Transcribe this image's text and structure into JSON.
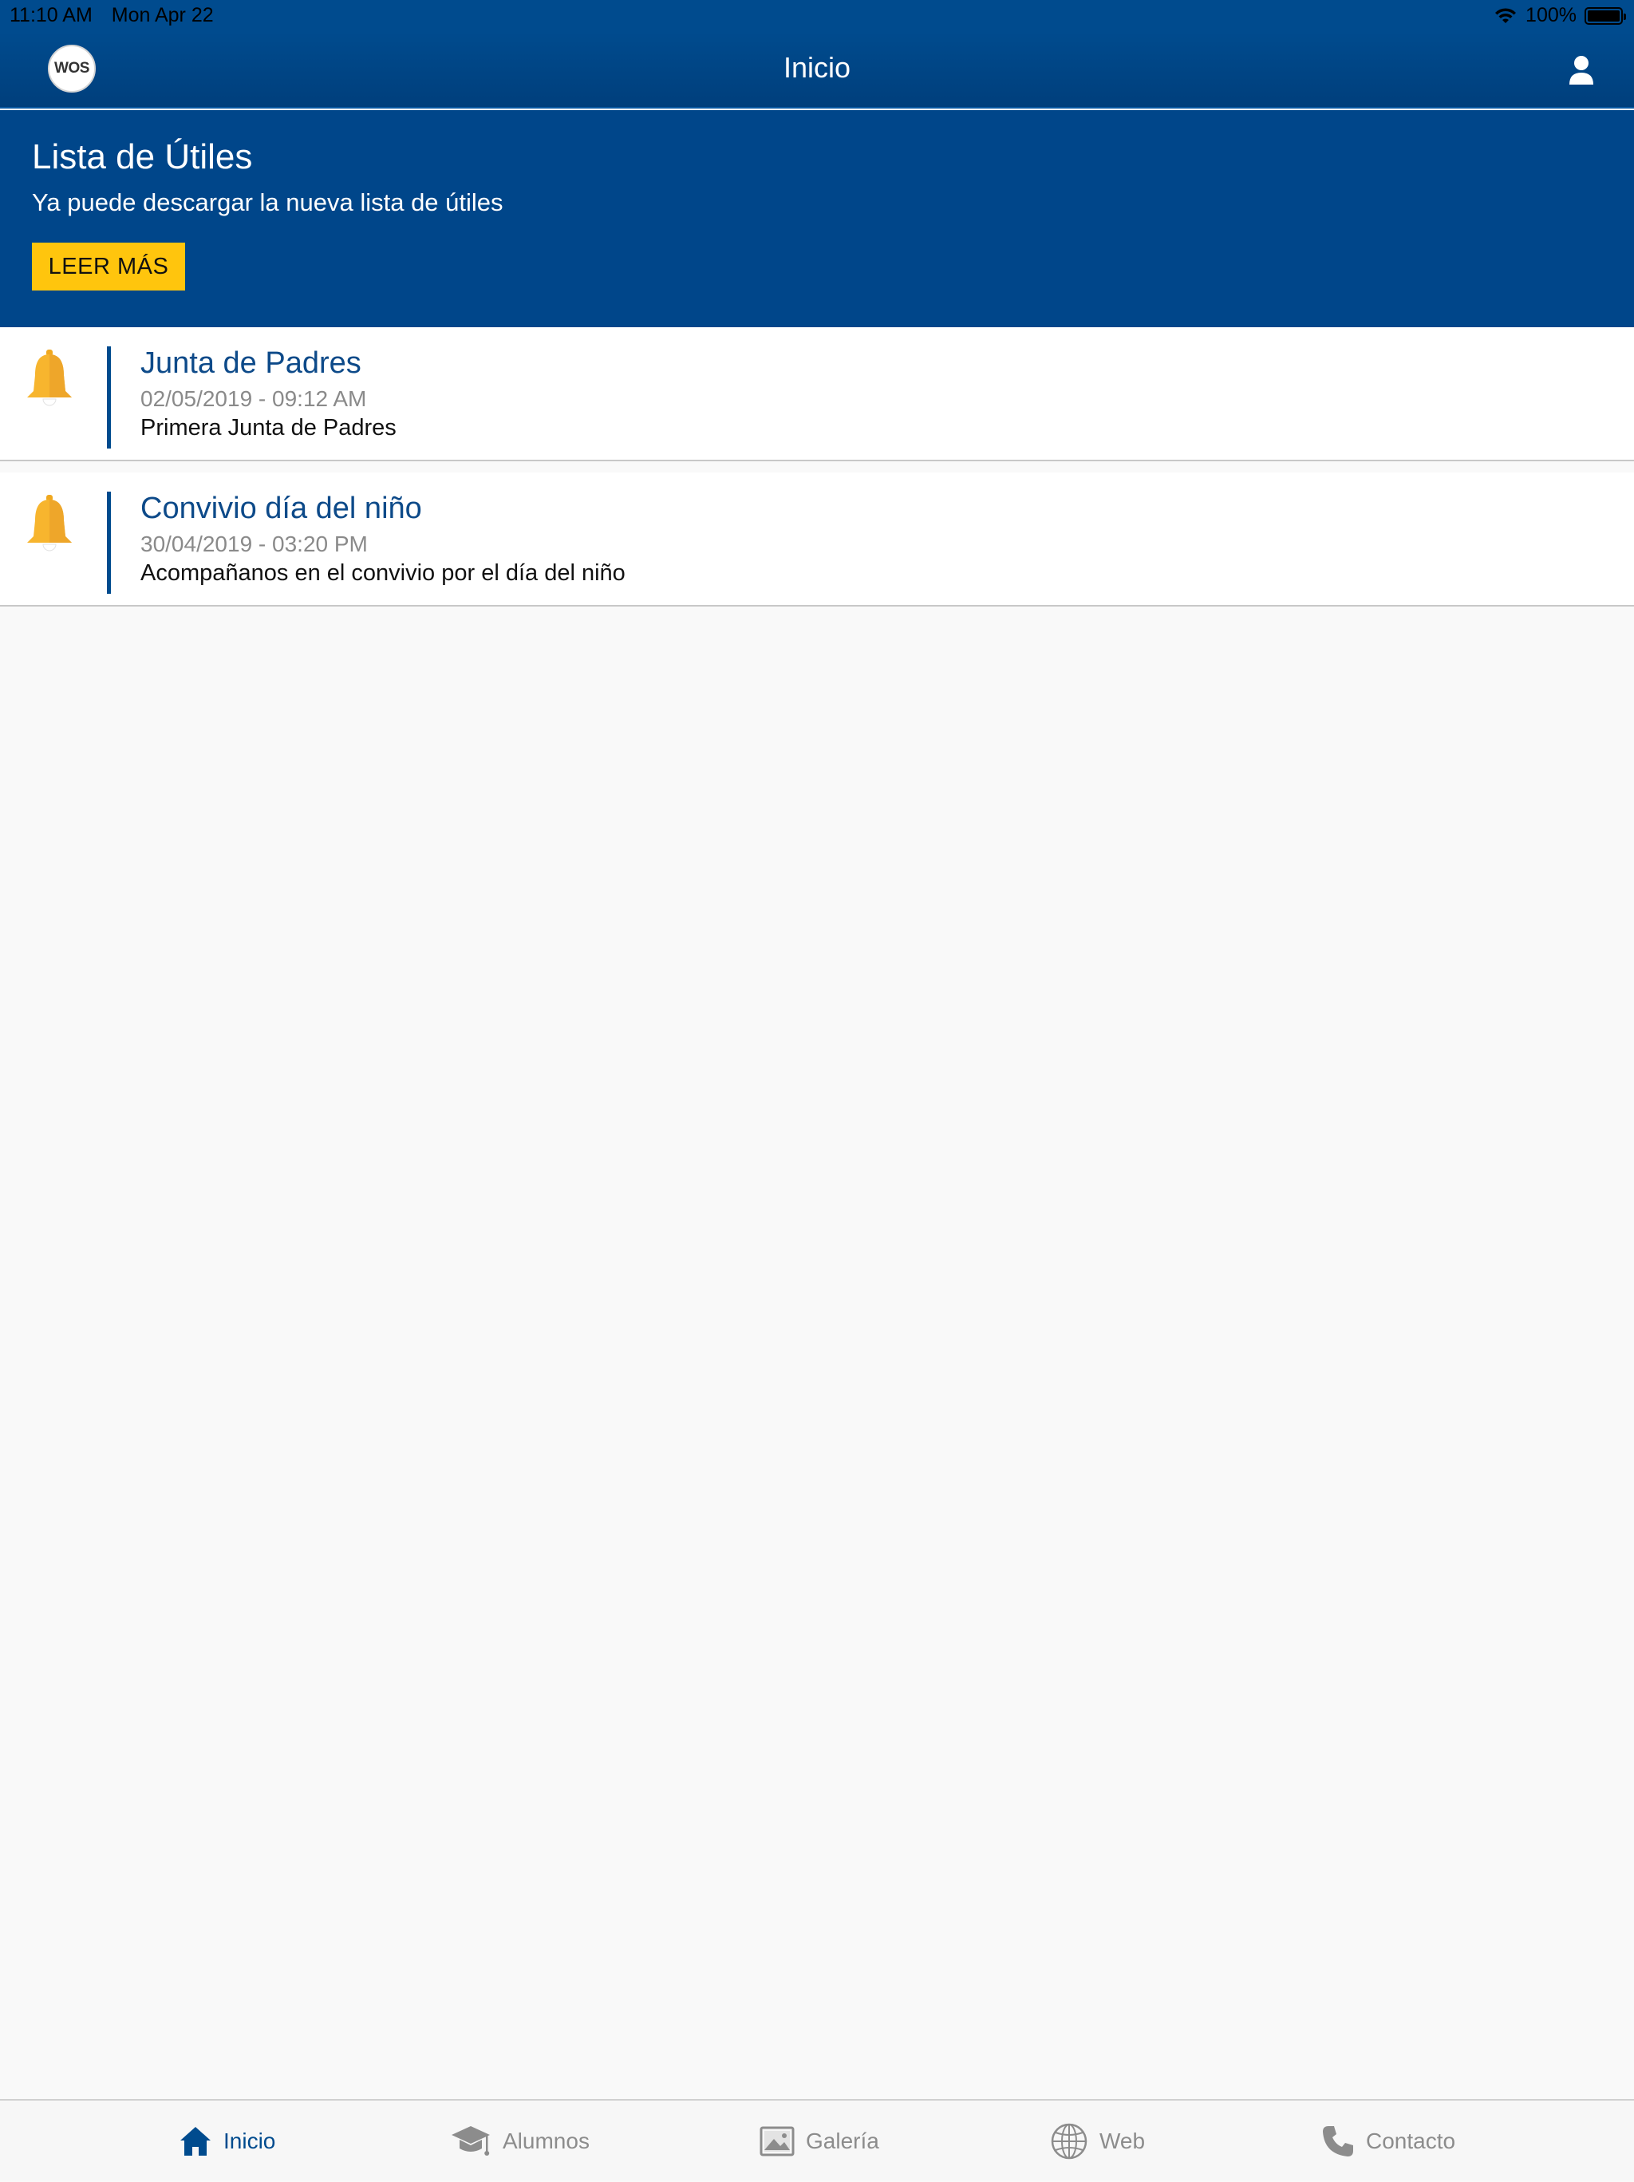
{
  "status_bar": {
    "time": "11:10 AM",
    "date": "Mon Apr 22",
    "battery": "100%"
  },
  "nav": {
    "logo_text": "WOS",
    "title": "Inicio"
  },
  "banner": {
    "title": "Lista de Útiles",
    "subtitle": "Ya puede descargar la nueva lista de útiles",
    "button_label": "LEER MÁS"
  },
  "notifications": [
    {
      "title": "Junta de Padres",
      "date": "02/05/2019 - 09:12 AM",
      "body": "Primera Junta de Padres"
    },
    {
      "title": "Convivio día del niño",
      "date": "30/04/2019 - 03:20 PM",
      "body": "Acompañanos en el convivio por el día del niño"
    }
  ],
  "tabs": [
    {
      "label": "Inicio",
      "icon": "home-icon",
      "active": true
    },
    {
      "label": "Alumnos",
      "icon": "graduation-cap-icon"
    },
    {
      "label": "Galería",
      "icon": "image-icon"
    },
    {
      "label": "Web",
      "icon": "globe-icon"
    },
    {
      "label": "Contacto",
      "icon": "phone-icon"
    }
  ],
  "colors": {
    "primary": "#004b8e",
    "accent": "#ffc50d",
    "bell": "#f7b52e"
  }
}
